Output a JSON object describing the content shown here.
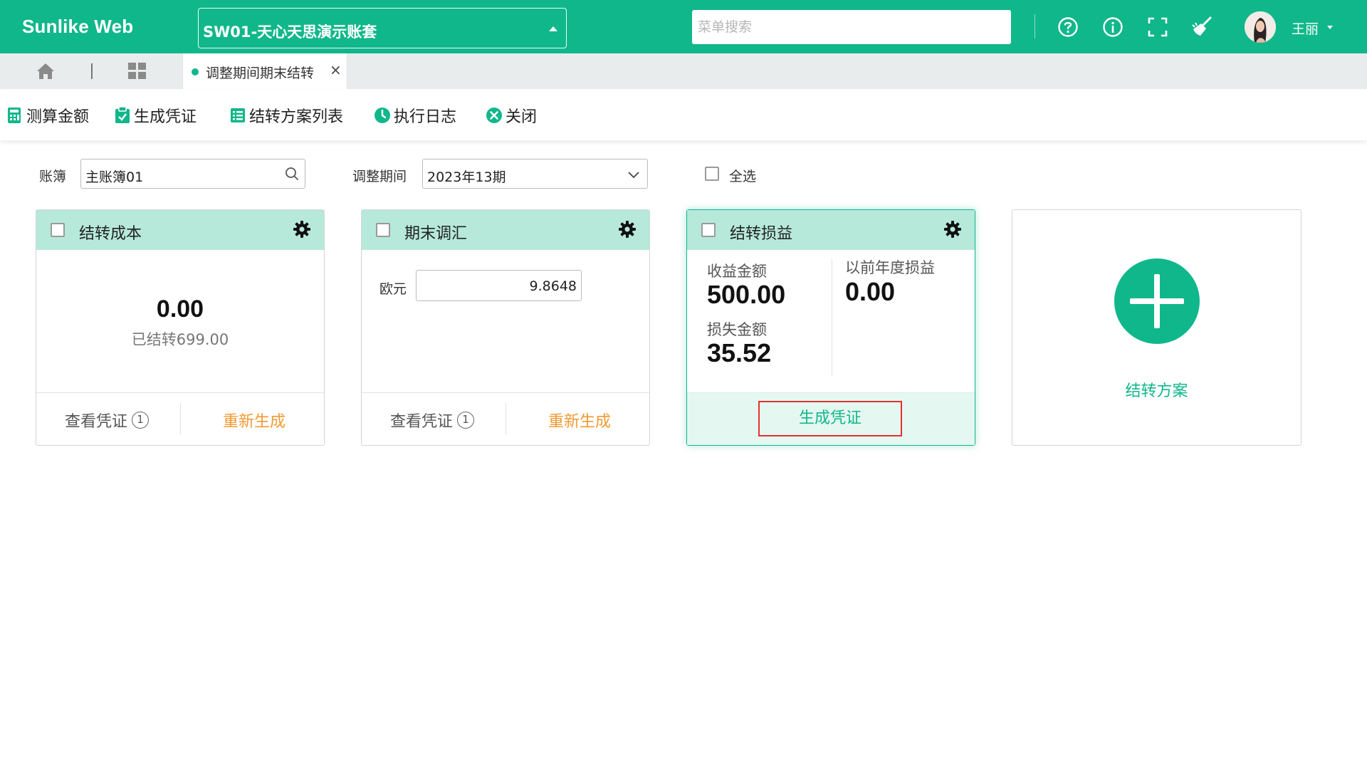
{
  "app": {
    "brand": "Sunlike Web",
    "account_set": "SW01-天心天思演示账套",
    "menu_search_placeholder": "菜单搜索",
    "user_name": "王丽"
  },
  "tabs": [
    {
      "label": "调整期间期末结转",
      "close": "×"
    }
  ],
  "toolbar": {
    "calc_label": "测算金额",
    "gen_voucher_label": "生成凭证",
    "scheme_list_label": "结转方案列表",
    "exec_log_label": "执行日志",
    "close_label": "关闭"
  },
  "filters": {
    "ledger_label": "账簿",
    "ledger_value": "主账簿01",
    "period_label": "调整期间",
    "period_value": "2023年13期",
    "select_all_label": "全选"
  },
  "cards": {
    "cost": {
      "title": "结转成本",
      "amount": "0.00",
      "transferred": "已结转699.00",
      "view_voucher": "查看凭证",
      "voucher_count": "1",
      "regenerate": "重新生成"
    },
    "fx": {
      "title": "期末调汇",
      "currency_label": "欧元",
      "rate_value": "9.8648",
      "view_voucher": "查看凭证",
      "voucher_count": "1",
      "regenerate": "重新生成"
    },
    "pl": {
      "title": "结转损益",
      "income_label": "收益金额",
      "income_value": "500.00",
      "loss_label": "损失金额",
      "loss_value": "35.52",
      "prior_label": "以前年度损益",
      "prior_value": "0.00",
      "generate": "生成凭证"
    },
    "add": {
      "label": "结转方案"
    }
  },
  "colors": {
    "brand_green": "#10b78b",
    "card_header": "#b6e9da",
    "orange": "#f29a32",
    "highlight_red": "#e5312c"
  }
}
